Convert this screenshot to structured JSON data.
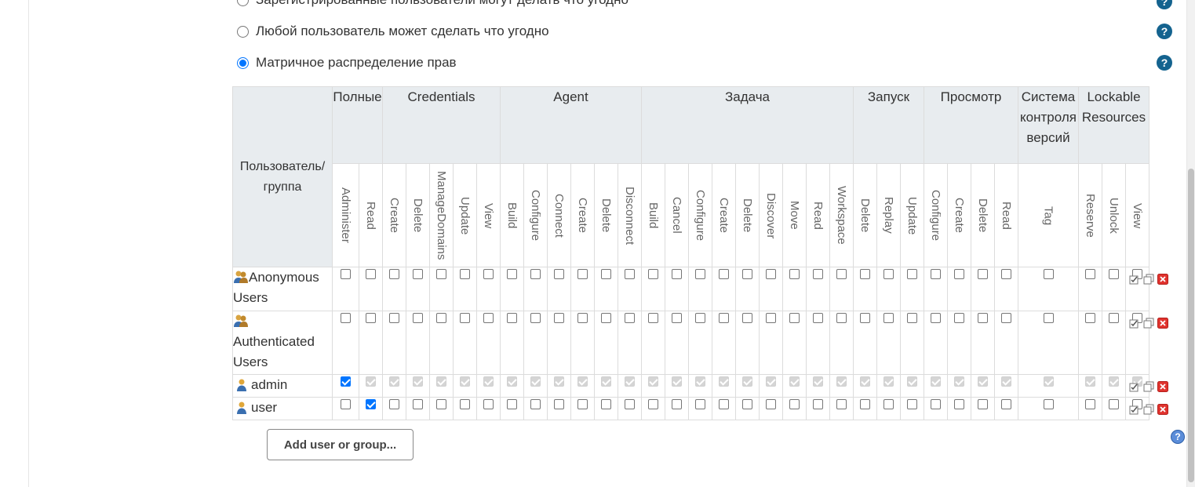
{
  "strategies": [
    {
      "label": "Зарегистрированные пользователи могут делать что угодно",
      "selected": false
    },
    {
      "label": "Любой пользователь может сделать что угодно",
      "selected": false
    },
    {
      "label": "Матричное распределение прав",
      "selected": true
    }
  ],
  "help_glyph": "?",
  "matrix": {
    "user_header": [
      "Пользователь/",
      "группа"
    ],
    "groups": [
      {
        "lines": [
          "Полные"
        ],
        "perms": [
          "Administer",
          "Read"
        ]
      },
      {
        "lines": [
          "Credentials"
        ],
        "perms": [
          "Create",
          "Delete",
          "ManageDomains",
          "Update",
          "View"
        ]
      },
      {
        "lines": [
          "Agent"
        ],
        "perms": [
          "Build",
          "Configure",
          "Connect",
          "Create",
          "Delete",
          "Disconnect"
        ]
      },
      {
        "lines": [
          "Задача"
        ],
        "perms": [
          "Build",
          "Cancel",
          "Configure",
          "Create",
          "Delete",
          "Discover",
          "Move",
          "Read",
          "Workspace"
        ]
      },
      {
        "lines": [
          "Запуск"
        ],
        "perms": [
          "Delete",
          "Replay",
          "Update"
        ]
      },
      {
        "lines": [
          "Просмотр"
        ],
        "perms": [
          "Configure",
          "Create",
          "Delete",
          "Read"
        ]
      },
      {
        "lines": [
          "Система",
          "контроля",
          "версий"
        ],
        "perms": [
          "Tag"
        ]
      },
      {
        "lines": [
          "Lockable",
          "Resources"
        ],
        "perms": [
          "Reserve",
          "Unlock",
          "View"
        ]
      }
    ],
    "rows": [
      {
        "name": [
          "Anonymous",
          "Users"
        ],
        "type": "group",
        "checked": [],
        "admin": false
      },
      {
        "name": [
          "",
          "Authenticated",
          "Users"
        ],
        "type": "group",
        "checked": [],
        "admin": false
      },
      {
        "name": [
          "admin"
        ],
        "type": "user",
        "checked": [
          0
        ],
        "admin": true
      },
      {
        "name": [
          "user"
        ],
        "type": "user",
        "checked": [
          1
        ],
        "admin": false
      }
    ]
  },
  "add_button_label": "Add user or group...",
  "colors": {
    "accent": "#0075ff",
    "help": "#14638f",
    "header_bg": "#e8ecef",
    "delete": "#e0332e"
  }
}
